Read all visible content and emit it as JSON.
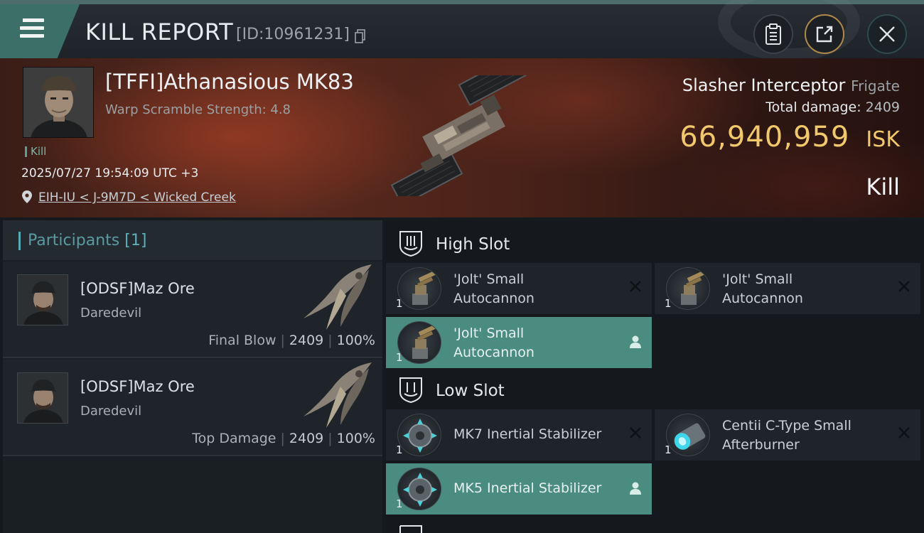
{
  "header": {
    "title": "KILL REPORT",
    "report_id": "[ID:10961231]",
    "icons": [
      "menu-icon",
      "copy-icon",
      "clipboard-icon",
      "share-icon",
      "close-icon"
    ]
  },
  "victim": {
    "name": "[TFFI]Athanasious MK83",
    "scramble": "Warp Scramble Strength: 4.8",
    "tag": "Kill",
    "timestamp": "2025/07/27 19:54:09 UTC +3",
    "location": "EIH-IU < J-9M7D < Wicked Creek",
    "ship_name": "Slasher Interceptor",
    "ship_class": "Frigate",
    "total_damage_label": "Total damage:",
    "total_damage": "2409",
    "isk_value": "66,940,959",
    "isk_unit": "ISK",
    "result": "Kill"
  },
  "participants": {
    "title": "Participants",
    "count": "[1]",
    "rows": [
      {
        "name": "[ODSF]Maz Ore",
        "ship": "Daredevil",
        "role": "Final Blow",
        "damage": "2409",
        "percent": "100%"
      },
      {
        "name": "[ODSF]Maz Ore",
        "ship": "Daredevil",
        "role": "Top Damage",
        "damage": "2409",
        "percent": "100%"
      }
    ]
  },
  "slots": {
    "high_label": "High Slot",
    "low_label": "Low Slot",
    "high": [
      {
        "line1": "'Jolt' Small",
        "line2": "Autocannon",
        "qty": "1",
        "state": "destroyed"
      },
      {
        "line1": "'Jolt' Small",
        "line2": "Autocannon",
        "qty": "1",
        "state": "destroyed"
      },
      {
        "line1": "'Jolt' Small",
        "line2": "Autocannon",
        "qty": "1",
        "state": "dropped"
      }
    ],
    "low": [
      {
        "line1": "MK7 Inertial Stabilizer",
        "qty": "1",
        "state": "destroyed"
      },
      {
        "line1": "Centii C-Type Small",
        "line2": "Afterburner",
        "qty": "1",
        "state": "destroyed"
      },
      {
        "line1": "MK5 Inertial Stabilizer",
        "qty": "1",
        "state": "dropped"
      }
    ]
  },
  "colors": {
    "accent": "#4a8c80",
    "isk": "#f2c86c",
    "header_teal": "#3b6f68"
  }
}
